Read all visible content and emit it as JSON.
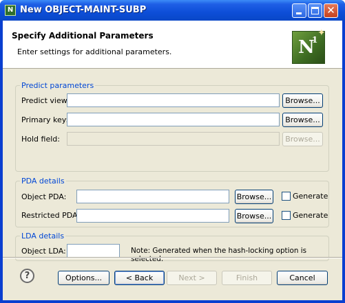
{
  "window": {
    "title": "New OBJECT-MAINT-SUBP",
    "app_icon": "natural-n1-icon"
  },
  "header": {
    "title": "Specify Additional Parameters",
    "subtitle": "Enter settings for additional parameters.",
    "logo_text": "N",
    "logo_sup": "1"
  },
  "predict": {
    "legend": "Predict parameters",
    "view_label": "Predict view:",
    "view_value": "",
    "key_label": "Primary key:",
    "key_value": "",
    "hold_label": "Hold field:",
    "hold_value": "",
    "browse": "Browse..."
  },
  "pda": {
    "legend": "PDA details",
    "object_label": "Object PDA:",
    "object_value": "",
    "restricted_label": "Restricted PDA:",
    "restricted_value": "",
    "browse": "Browse...",
    "generate": "Generate"
  },
  "lda": {
    "legend": "LDA details",
    "object_label": "Object LDA:",
    "object_value": "",
    "note": "Note: Generated when the hash-locking option is selected."
  },
  "footer": {
    "help": "?",
    "options": "Options...",
    "back": "< Back",
    "next": "Next >",
    "finish": "Finish",
    "cancel": "Cancel"
  }
}
